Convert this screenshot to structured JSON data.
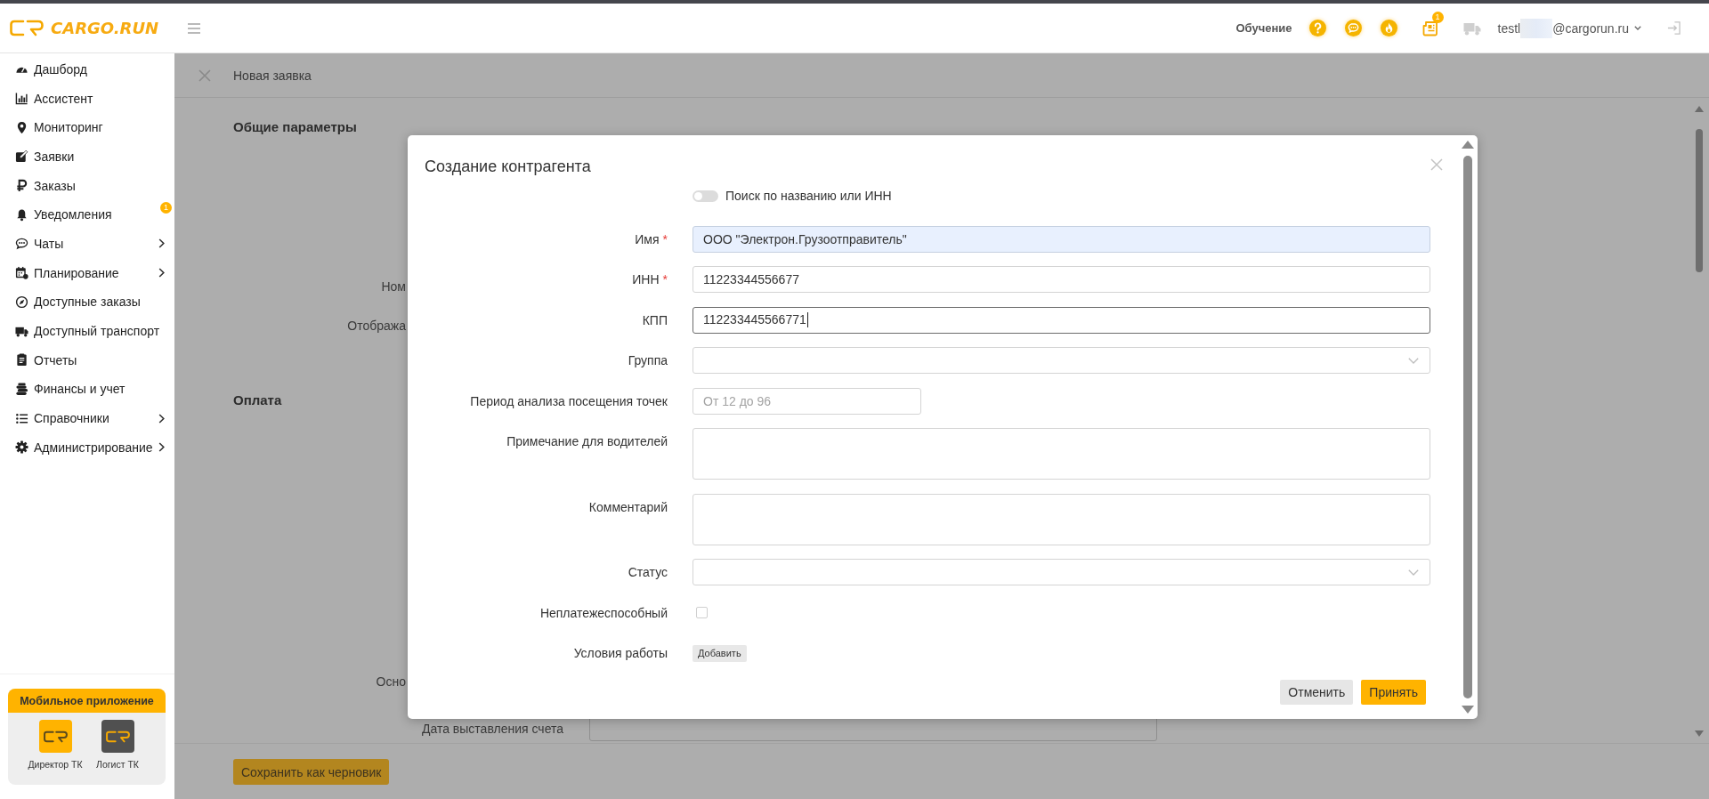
{
  "top_bar": {
    "logo_text": "CARGO.RUN",
    "learning_label": "Обучение",
    "notification_badge": "1",
    "user_email_start": "testl",
    "user_email_end": "@cargorun.ru"
  },
  "sidebar": {
    "items": [
      {
        "label": "Дашборд",
        "has_submenu": false
      },
      {
        "label": "Ассистент",
        "has_submenu": false
      },
      {
        "label": "Мониторинг",
        "has_submenu": false
      },
      {
        "label": "Заявки",
        "has_submenu": false
      },
      {
        "label": "Заказы",
        "has_submenu": false
      },
      {
        "label": "Уведомления",
        "has_submenu": false,
        "badge": "1"
      },
      {
        "label": "Чаты",
        "has_submenu": true
      },
      {
        "label": "Планирование",
        "has_submenu": true
      },
      {
        "label": "Доступные заказы",
        "has_submenu": false
      },
      {
        "label": "Доступный транспорт",
        "has_submenu": false
      },
      {
        "label": "Отчеты",
        "has_submenu": false
      },
      {
        "label": "Финансы и учет",
        "has_submenu": false
      },
      {
        "label": "Справочники",
        "has_submenu": true
      },
      {
        "label": "Администрирование",
        "has_submenu": true
      }
    ],
    "mobile_app": {
      "title": "Мобильное приложение",
      "apps": [
        {
          "label": "Директор ТК",
          "color": "#ffb300"
        },
        {
          "label": "Логист ТК",
          "color": "#505050"
        }
      ]
    }
  },
  "page": {
    "title": "Новая заявка",
    "sections": [
      {
        "title": "Общие параметры",
        "rows": [
          {
            "kind": "label",
            "label": "Ном"
          },
          {
            "kind": "label",
            "label": "Отобража"
          }
        ]
      },
      {
        "title": "Оплата",
        "rows": [
          {
            "kind": "label",
            "label": "Осно"
          },
          {
            "kind": "field",
            "label": "Дата выставления счета"
          }
        ]
      }
    ],
    "save_draft_button": "Сохранить как черновик"
  },
  "modal": {
    "title": "Создание контрагента",
    "search_toggle": {
      "label": "Поиск по названию или ИНН",
      "on": false
    },
    "fields": [
      {
        "kind": "input",
        "label": "Имя",
        "mark": "*",
        "value": "ООО \"Электрон.Грузоотправитель\"",
        "autofilled": true,
        "focused": false
      },
      {
        "kind": "input",
        "label": "ИНН",
        "mark": "*",
        "value": "11223344556677",
        "autofilled": false,
        "focused": false
      },
      {
        "kind": "input",
        "label": "КПП",
        "value": "112233445566771",
        "autofilled": false,
        "focused": true
      },
      {
        "kind": "select",
        "label": "Группа",
        "autofilled": false,
        "focused": false
      },
      {
        "kind": "short_input",
        "label": "Период анализа посещения точек",
        "placeholder": "От 12 до 96",
        "autofilled": false,
        "focused": false
      },
      {
        "kind": "textarea",
        "label": "Примечание для водителей",
        "autofilled": false,
        "focused": false
      },
      {
        "kind": "textarea",
        "label": "Комментарий",
        "autofilled": false,
        "focused": false
      },
      {
        "kind": "select",
        "label": "Статус",
        "autofilled": false,
        "focused": false
      },
      {
        "kind": "checkbox",
        "label": "Неплатежеспособный",
        "checked": false,
        "autofilled": false,
        "focused": false
      },
      {
        "kind": "button",
        "label": "Условия работы",
        "button_label": "Добавить",
        "autofilled": false,
        "focused": false
      }
    ],
    "buttons": [
      {
        "kind": "secondary",
        "label": "Отменить"
      },
      {
        "kind": "primary",
        "label": "Принять"
      }
    ]
  }
}
